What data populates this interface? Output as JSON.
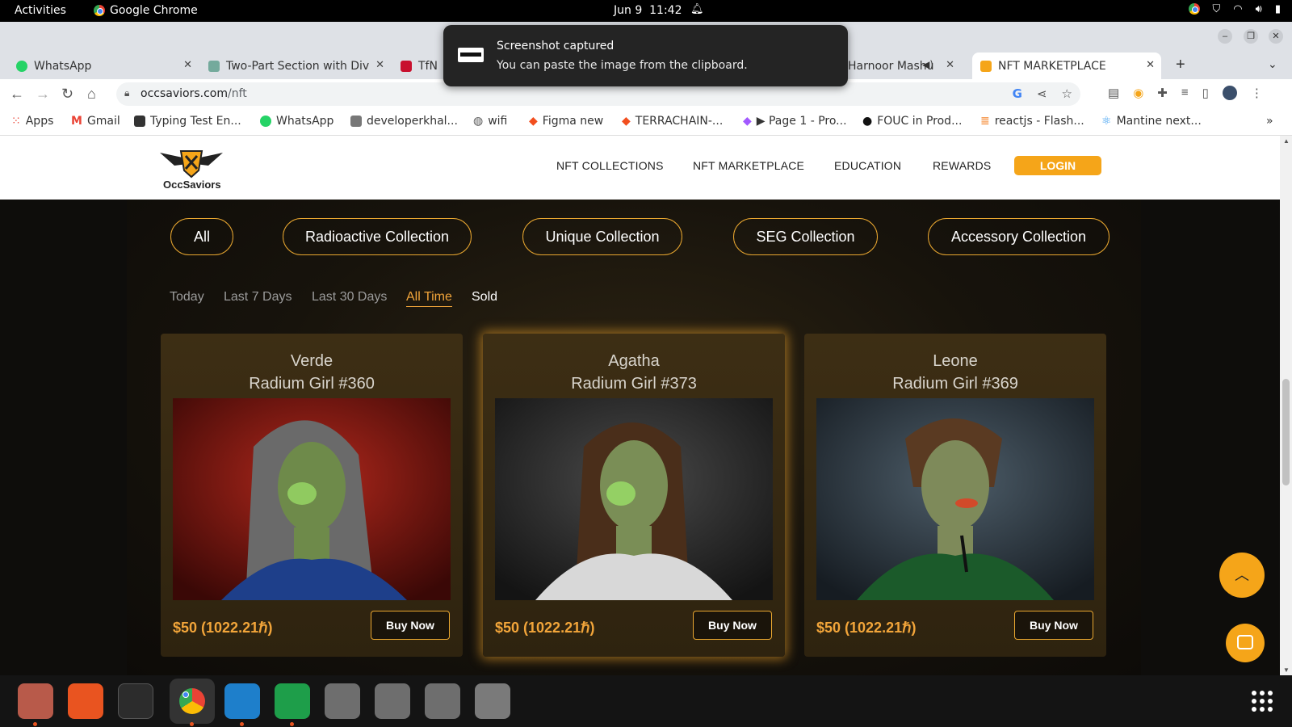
{
  "topbar": {
    "activities": "Activities",
    "app_name": "Google Chrome",
    "date": "Jun 9",
    "time": "11:42"
  },
  "notification": {
    "title": "Screenshot captured",
    "body": "You can paste the image from the clipboard."
  },
  "tabs": [
    {
      "label": "WhatsApp",
      "favicon_color": "#25d366"
    },
    {
      "label": "Two-Part Section with Div",
      "favicon_color": "#74aa9c"
    },
    {
      "label": "TfN",
      "favicon_color": "#c8102e"
    },
    {
      "label": "Harnoor Mashu",
      "favicon_color": "#ff0000"
    },
    {
      "label": "NFT MARKETPLACE",
      "favicon_color": "#f5a519"
    }
  ],
  "address_bar": {
    "domain": "occsaviors.com",
    "path": "/nft"
  },
  "bookmarks": [
    {
      "label": "Apps",
      "icon": "apps-grid-icon",
      "color": "#ea4335"
    },
    {
      "label": "Gmail",
      "icon": "gmail-icon",
      "color": "#ea4335"
    },
    {
      "label": "Typing Test En...",
      "icon": "typing-test-icon",
      "color": "#333333"
    },
    {
      "label": "WhatsApp",
      "icon": "whatsapp-icon",
      "color": "#25d366"
    },
    {
      "label": "developerkhal...",
      "icon": "dev-icon",
      "color": "#777777"
    },
    {
      "label": "wifi",
      "icon": "globe-icon",
      "color": "#555555"
    },
    {
      "label": "Figma new",
      "icon": "figma-icon",
      "color": "#f24e1e"
    },
    {
      "label": "TERRACHAIN-...",
      "icon": "figma-icon",
      "color": "#f24e1e"
    },
    {
      "label": "▶ Page 1 - Pro...",
      "icon": "figma-icon",
      "color": "#a259ff"
    },
    {
      "label": "FOUC in Prod...",
      "icon": "github-icon",
      "color": "#111111"
    },
    {
      "label": "reactjs - Flash...",
      "icon": "stackoverflow-icon",
      "color": "#f48024"
    },
    {
      "label": "Mantine next...",
      "icon": "react-icon",
      "color": "#339af0"
    }
  ],
  "site": {
    "logo_text": "OccSaviors",
    "nav": [
      "NFT COLLECTIONS",
      "NFT MARKETPLACE",
      "EDUCATION",
      "REWARDS"
    ],
    "login": "LOGIN"
  },
  "collections": [
    "All",
    "Radioactive Collection",
    "Unique Collection",
    "SEG Collection",
    "Accessory Collection"
  ],
  "time_filters": {
    "items": [
      "Today",
      "Last 7 Days",
      "Last 30 Days",
      "All Time",
      "Sold"
    ],
    "active": "All Time"
  },
  "cards": [
    {
      "name": "Verde",
      "title": "Radium Girl #360",
      "price": "$50 (1022.21ℏ)",
      "button": "Buy Now",
      "bg": "#7a1410",
      "hair": "#6a6a6a",
      "dress": "#1e3f8a"
    },
    {
      "name": "Agatha",
      "title": "Radium Girl #373",
      "price": "$50 (1022.21ℏ)",
      "button": "Buy Now",
      "bg": "#2c2c2c",
      "hair": "#4a2e1a",
      "dress": "#d8d8d8"
    },
    {
      "name": "Leone",
      "title": "Radium Girl #369",
      "price": "$50 (1022.21ℏ)",
      "button": "Buy Now",
      "bg": "#2a3440",
      "hair": "#5a3a22",
      "dress": "#1b5a2a"
    }
  ],
  "colors": {
    "accent": "#f5a519",
    "price": "#f2a53a",
    "pill_border": "#e9a730"
  }
}
